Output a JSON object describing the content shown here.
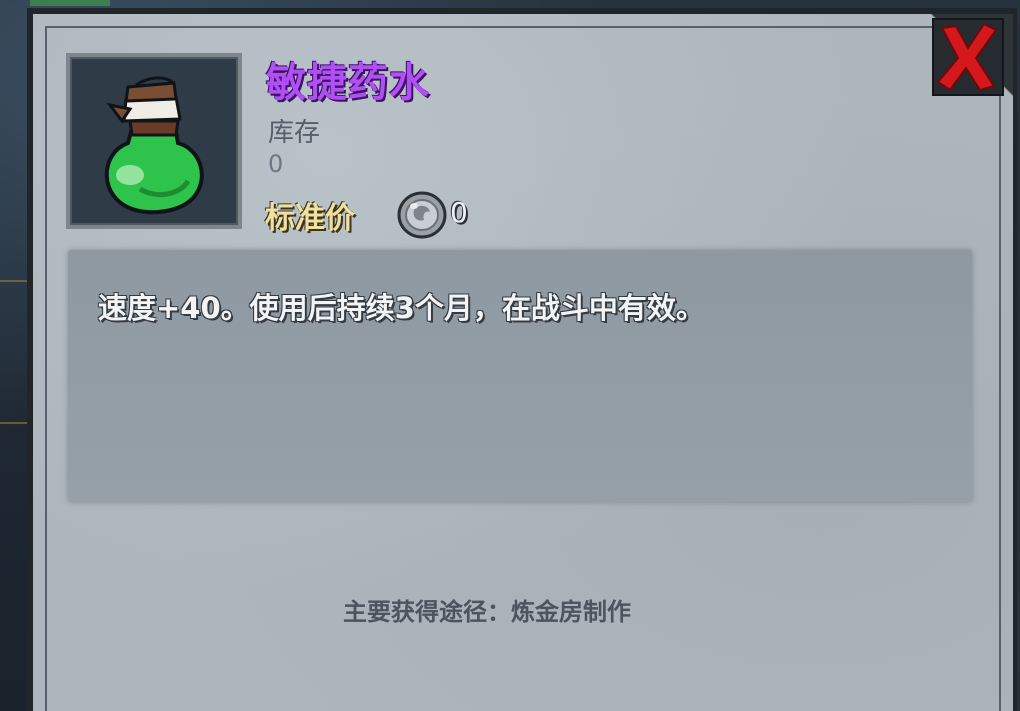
{
  "item": {
    "name": "敏捷药水",
    "icon": "green-potion-icon",
    "stock_label": "库存",
    "stock_value": "0",
    "price_label": "标准价",
    "price_icon": "silver-coin-icon",
    "price_value": "0",
    "description": "速度+40。使用后持续3个月，在战斗中有效。",
    "source": "主要获得途径：炼金房制作"
  },
  "colors": {
    "title": "#b24ef5",
    "price_label": "#f0e1a0",
    "close_x": "#d4181b",
    "potion_liquid": "#2ec34a"
  }
}
